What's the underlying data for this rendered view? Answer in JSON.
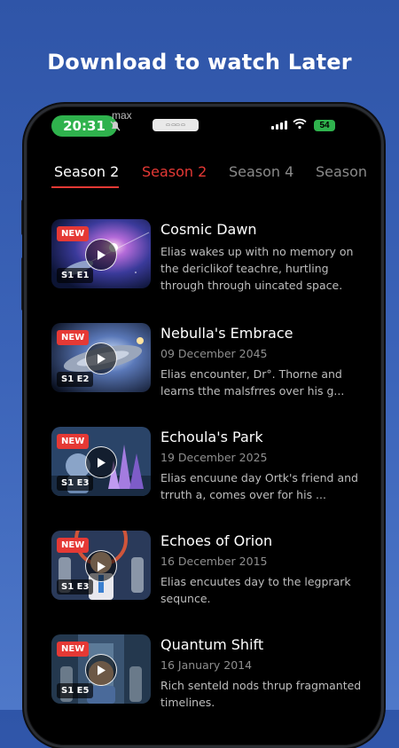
{
  "headline": "Download to watch Later",
  "status_bar": {
    "time": "20:31",
    "app_label": "max",
    "battery": "54"
  },
  "tabs": [
    {
      "label": "Season 2",
      "state": "active"
    },
    {
      "label": "Season 2",
      "state": "highlighted"
    },
    {
      "label": "Season 4",
      "state": "inactive"
    },
    {
      "label": "Season",
      "state": "inactive"
    }
  ],
  "colors": {
    "accent": "#e53935",
    "background": "#000000",
    "banner": "#3b63b8",
    "time_pill": "#2fb24d"
  },
  "episodes": [
    {
      "badge": "NEW",
      "episode": "S1 E1",
      "title": "Cosmic Dawn",
      "date": "",
      "description": "Elias wakes up with no memory on the dericlikof teachre, hurtling through through uincated space.",
      "thumb": "cosmic"
    },
    {
      "badge": "NEW",
      "episode": "S1 E2",
      "title": "Nebulla's Embrace",
      "date": "09 December 2045",
      "description": "Elias encounter, Dr°. Thorne and learns tthe malsfrres over his g...",
      "thumb": "ship"
    },
    {
      "badge": "NEW",
      "episode": "S1 E3",
      "title": "Echoula's Park",
      "date": "19 December 2025",
      "description": "Elias encuune day Ortk's friend and trruth a, comes over for his ...",
      "thumb": "crystal"
    },
    {
      "badge": "NEW",
      "episode": "S1 E3",
      "title": "Echoes of Orion",
      "date": "16 December 2015",
      "description": "Elias encuutes day to the legprark sequnce.",
      "thumb": "robots"
    },
    {
      "badge": "NEW",
      "episode": "S1 E5",
      "title": "Quantum Shift",
      "date": "16 January 2014",
      "description": "Rich senteld nods thrup fragmanted timelines.",
      "thumb": "corridor"
    }
  ]
}
